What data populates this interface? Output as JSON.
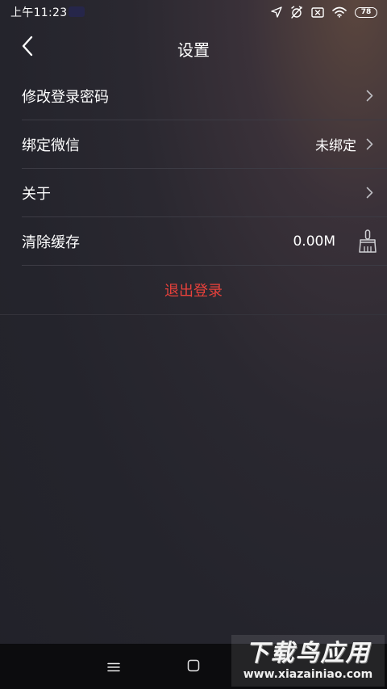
{
  "status_bar": {
    "time": "上午11:23",
    "battery": "78"
  },
  "header": {
    "title": "设置"
  },
  "settings": {
    "change_password": {
      "label": "修改登录密码"
    },
    "bind_wechat": {
      "label": "绑定微信",
      "value": "未绑定"
    },
    "about": {
      "label": "关于"
    },
    "clear_cache": {
      "label": "清除缓存",
      "value": "0.00M"
    }
  },
  "logout": {
    "label": "退出登录"
  },
  "watermark": {
    "title": "下载鸟应用",
    "url": "www.xiazainiao.com"
  },
  "colors": {
    "accent_red": "#e8413b",
    "background": "#24242c",
    "divider": "#3c3b44"
  },
  "icons": {
    "back": "chevron-left-icon",
    "row_arrow": "chevron-right-icon",
    "clear_cache": "broom-icon",
    "nav_menu": "menu-icon",
    "nav_home": "square-home-icon"
  }
}
